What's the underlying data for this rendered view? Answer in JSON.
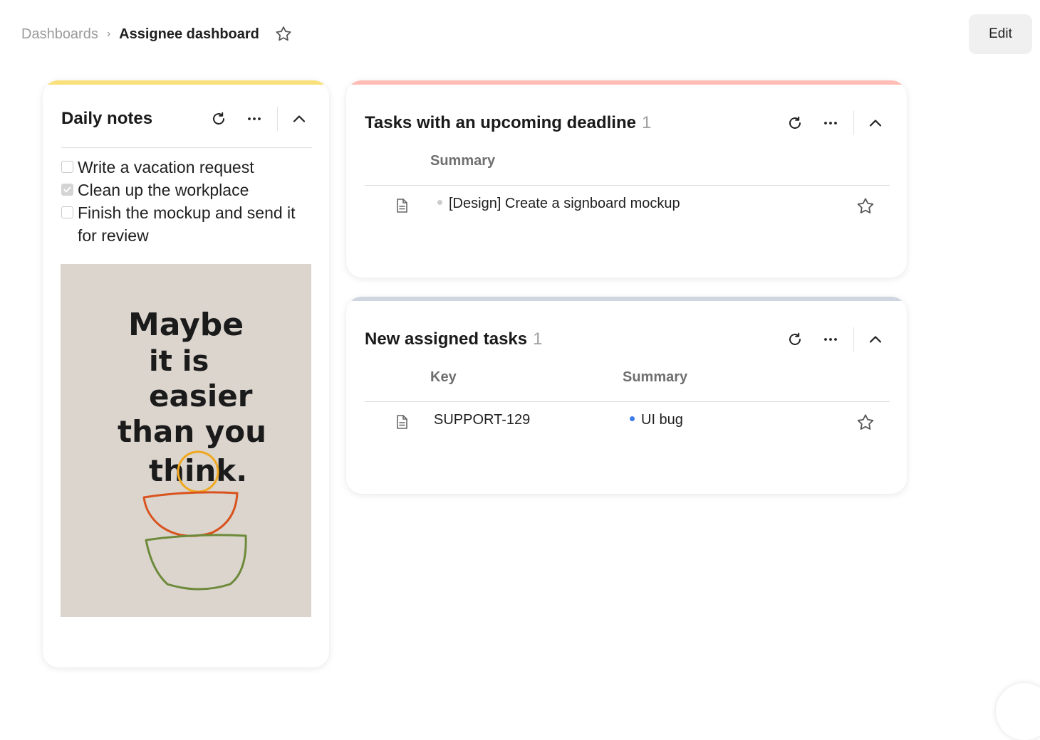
{
  "breadcrumb": {
    "parent": "Dashboards",
    "separator": "›",
    "current": "Assignee dashboard"
  },
  "header": {
    "edit_label": "Edit"
  },
  "cards": {
    "notes": {
      "title": "Daily notes",
      "accent_color": "#f9e07a",
      "checklist": [
        {
          "text": "Write a vacation request",
          "checked": false
        },
        {
          "text": "Clean up the workplace",
          "checked": true
        },
        {
          "text": "Finish the mockup and send it for review",
          "checked": false
        }
      ],
      "image": {
        "lines": [
          "Maybe",
          "it is",
          "easier",
          "than you",
          "think."
        ]
      }
    },
    "deadline": {
      "title": "Tasks with an upcoming deadline",
      "count": "1",
      "accent_color": "#ffbdb6",
      "columns": {
        "summary": "Summary"
      },
      "rows": [
        {
          "summary": "[Design] Create a signboard mockup",
          "dot_color": "#cccccc"
        }
      ]
    },
    "assigned": {
      "title": "New assigned tasks",
      "count": "1",
      "accent_color": "#cfd6e0",
      "columns": {
        "key": "Key",
        "summary": "Summary"
      },
      "rows": [
        {
          "key": "SUPPORT-129",
          "summary": "UI bug",
          "dot_color": "#3f7cf0"
        }
      ]
    }
  },
  "icons": {
    "favorite": "star-outline-icon",
    "refresh": "refresh-icon",
    "more": "more-horizontal-icon",
    "collapse": "chevron-up-icon",
    "document": "document-icon"
  }
}
